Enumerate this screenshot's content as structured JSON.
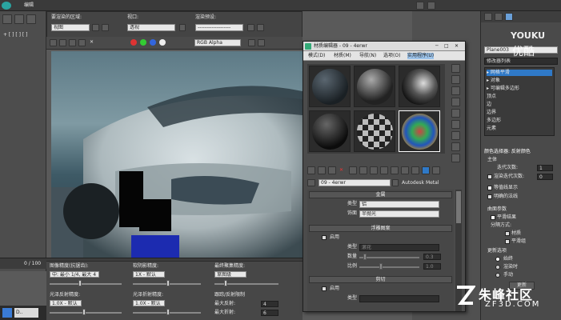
{
  "app": {
    "window_title": "编辑"
  },
  "render_setup": {
    "target_label": "要渲染的区域:",
    "target_value": "视图",
    "viewport_label": "视口:",
    "viewport_value": "透视",
    "preset_label": "渲染预设:",
    "preset_value": "-------------------",
    "channel_value": "RGB Alpha"
  },
  "timeline": {
    "frame_counter": "0 / 100"
  },
  "status_bar": {
    "shadow_label": "图像精度(抗锯齿):",
    "shadow_value": "中: 最小 1/4, 最大 4",
    "glossy_label": "软阴影精度:",
    "glossy_value": "1X - 默认",
    "final_label": "最终聚集精度:",
    "final_value": "草图级",
    "spec_label": "光泽反射精度:",
    "spec_value": "1.0X - 默认",
    "refr_label": "光泽折射精度:",
    "refr_value": "1.0X - 默认",
    "trace_label": "跟踪/反射限制",
    "max_reflect_label": "最大反射:",
    "max_reflect_value": "4",
    "max_refract_label": "最大折射:",
    "max_refract_value": "6"
  },
  "material_editor": {
    "title": "材质编辑器 - 09 - 4erwr",
    "menu": [
      "模式(D)",
      "材质(M)",
      "导航(N)",
      "选项(O)",
      "实用程序(U)"
    ],
    "material_name": "09 - 4erwr",
    "material_type": "Autodesk Metal",
    "section_metal": "金属",
    "type_label": "类型",
    "type_value": "铝",
    "finish_label": "饰面",
    "finish_value": "半抛光",
    "section_relief": "浮雕图案",
    "enable_label": "启用",
    "relief_type_label": "类型",
    "relief_type_value": "滚花",
    "amount_label": "数量",
    "amount_value": "0.3",
    "scale_label": "比例",
    "scale_value": "1.0",
    "section_cutout": "剪切",
    "enable2_label": "启用",
    "cut_type_label": "类型"
  },
  "command_panel": {
    "object_name": "Plane003",
    "modifier_list_label": "修改器列表",
    "stack_items": [
      "▸ 网格平滑",
      "  ▸ 对象",
      "▸ 可编辑多边形",
      "    顶点",
      "    边",
      "    边界",
      "    多边形",
      "    元素"
    ],
    "rollout_reflect": "颜色选择器: 反射颜色",
    "section_main": "主体",
    "iterations_label": "迭代次数:",
    "iterations_value": "1",
    "render_iter_label": "渲染迭代次数:",
    "render_iter_value": "0",
    "isoline_label": "等值线显示",
    "explicit_label": "明确的法线",
    "section_surface": "曲面参数",
    "smooth_label": "平滑结果",
    "separate_label": "分隔方式:",
    "material_label": "材质",
    "group_label": "平滑组",
    "section_update": "更新选项",
    "always_label": "始终",
    "render_label": "渲染时",
    "manual_label": "手动",
    "update_button": "更新"
  },
  "overlay": {
    "watermark_brand": "YOUKU",
    "watermark_text": "优酷",
    "site_name": "朱峰社区",
    "site_url": "ZF3D.COM"
  },
  "colors": {
    "accent": "#2f79c7",
    "toolbar": "#454545",
    "panel": "#4a4a4a"
  }
}
